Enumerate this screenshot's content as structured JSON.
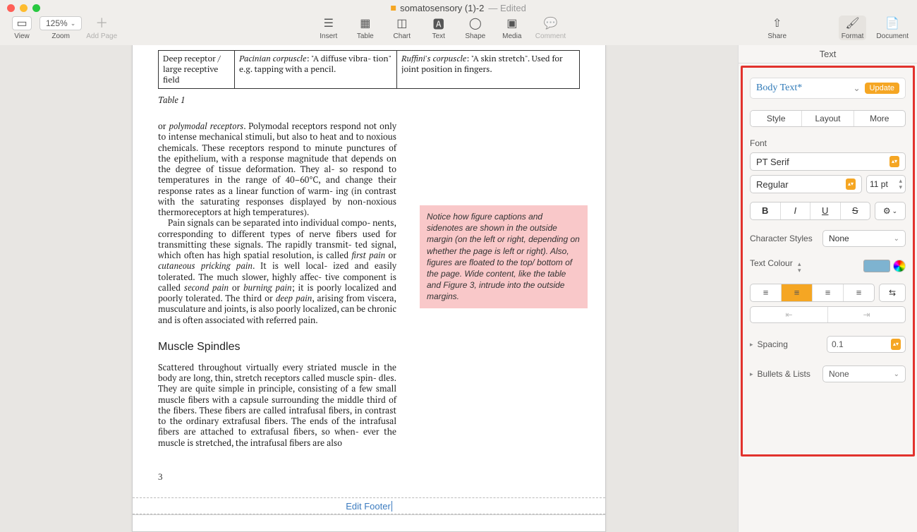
{
  "window": {
    "title": "somatosensory (1)-2",
    "edited": "— Edited"
  },
  "toolbar": {
    "view": "View",
    "zoom_value": "125%",
    "zoom": "Zoom",
    "add_page": "Add Page",
    "insert": "Insert",
    "table": "Table",
    "chart": "Chart",
    "text": "Text",
    "shape": "Shape",
    "media": "Media",
    "comment": "Comment",
    "share": "Share",
    "format": "Format",
    "document": "Document"
  },
  "document": {
    "table": {
      "r1c1": "Deep receptor / large receptive field",
      "r1c2a": "Pacinian corpuscle",
      "r1c2b": ": \"A diffuse vibra- tion\" e.g. tapping with a pencil.",
      "r1c3a": "Ruffini's corpuscle",
      "r1c3b": ": \"A skin stretch\". Used for joint position in fingers."
    },
    "table_caption": "Table 1",
    "p1a": "or ",
    "p1b": "polymodal receptors",
    "p1c": ". Polymodal receptors respond not only to intense mechanical stimuli, but also to heat and to noxious chemicals. These receptors respond to minute punctures of the epithelium, with a response magnitude that depends on the degree of tissue deformation. They al- so respond to temperatures in the range of 40–60°C, and change their response rates as a linear function of warm- ing (in contrast with the saturating responses displayed by non-noxious thermoreceptors at high temperatures).",
    "p2a": "Pain signals can be separated into individual compo- nents, corresponding to different types of nerve fibers used for transmitting these signals. The rapidly transmit- ted signal, which often has high spatial resolution, is called ",
    "p2b": "first pain",
    "p2c": " or ",
    "p2d": "cutaneous pricking pain",
    "p2e": ". It is well local- ized and easily tolerated. The much slower, highly affec- tive component is called ",
    "p2f": "second pain",
    "p2g": " or ",
    "p2h": "burning pain",
    "p2i": "; it is poorly localized and poorly tolerated. The third or ",
    "p2j": "deep pain",
    "p2k": ", arising from viscera, musculature and joints, is also poorly localized, can be chronic and is often associated with referred pain.",
    "h2": "Muscle Spindles",
    "p3": "Scattered throughout virtually every striated muscle in the body are long, thin, stretch receptors called muscle spin- dles. They are quite simple in principle, consisting of a few small muscle fibers with a capsule surrounding the middle third of the fibers. These fibers are called intrafusal fibers, in contrast to the ordinary extrafusal fibers. The ends of the intrafusal fibers are attached to extrafusal fibers, so when- ever the muscle is stretched, the intrafusal fibers are also",
    "sidenote": "Notice how figure captions and sidenotes are shown in the outside margin (on the left or right, depending on whether the page is left or right). Also, figures are floated to the top/ bottom of the page. Wide content, like the table and Figure 3, intrude into the outside margins.",
    "page_number": "3",
    "footer": "Edit Footer"
  },
  "inspector": {
    "tab_label": "Text",
    "style_name": "Body Text*",
    "update": "Update",
    "tabs": {
      "style": "Style",
      "layout": "Layout",
      "more": "More"
    },
    "font_label": "Font",
    "font_family": "PT Serif",
    "font_weight": "Regular",
    "font_size": "11 pt",
    "char_styles_label": "Character Styles",
    "char_styles_value": "None",
    "text_colour_label": "Text Colour",
    "spacing_label": "Spacing",
    "spacing_value": "0.1",
    "bullets_label": "Bullets & Lists",
    "bullets_value": "None"
  }
}
